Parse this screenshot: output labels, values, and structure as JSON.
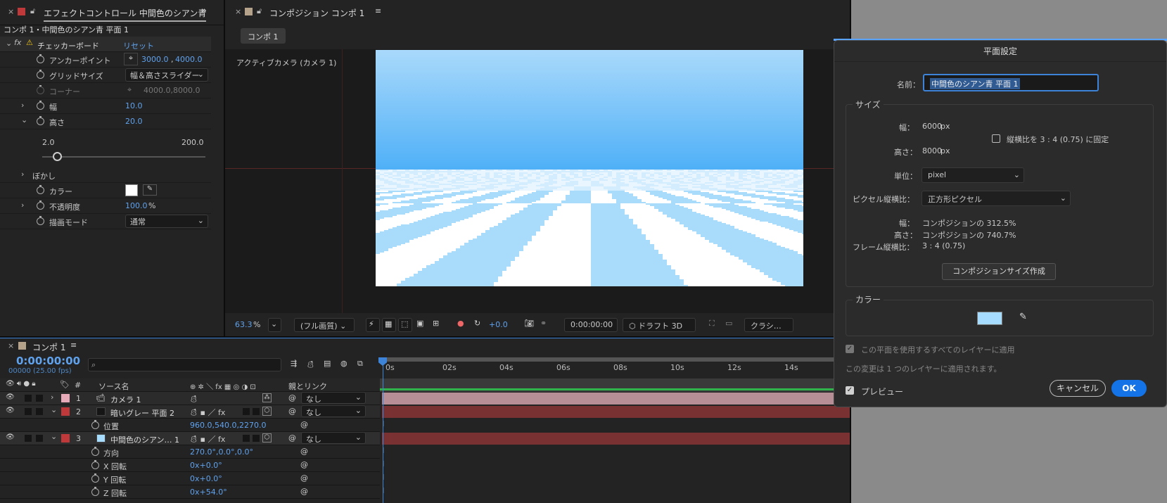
{
  "effect_panel": {
    "tab_title": "エフェクトコントロール 中間色のシアン青",
    "breadcrumb": "コンポ 1・中間色のシアン青 平面 1",
    "effect_name": "チェッカーボード",
    "reset": "リセット",
    "anchor": {
      "label": "アンカーポイント",
      "x": "3000.0",
      "sep": ",",
      "y": "4000.0"
    },
    "grid_size": {
      "label": "グリッドサイズ",
      "value": "幅＆高さスライダー"
    },
    "corner": {
      "label": "コーナー",
      "value": "4000.0,8000.0"
    },
    "width": {
      "label": "幅",
      "value": "10.0"
    },
    "height": {
      "label": "高さ",
      "value": "20.0",
      "min": "2.0",
      "max": "200.0",
      "slider_fraction": 0.09
    },
    "blur": {
      "label": "ぼかし"
    },
    "color": {
      "label": "カラー",
      "swatch": "#ffffff"
    },
    "opacity": {
      "label": "不透明度",
      "value": "100.0",
      "unit": "%"
    },
    "blend": {
      "label": "描画モード",
      "value": "通常"
    }
  },
  "comp_panel": {
    "tab_title": "コンポジション コンポ 1",
    "sub_tab": "コンポ 1",
    "camera_label": "アクティブカメラ (カメラ 1)",
    "zoom": "63.3",
    "zoom_unit": "%",
    "quality": "(フル画質)",
    "exposure": "+0.0",
    "timecode": "0:00:00:00",
    "renderer": "ドラフト 3D",
    "classic": "クラシ…",
    "sky_top": "#a9d9fb",
    "sky_bottom": "#4fb0f7",
    "checker_color": "#a9dcfb"
  },
  "timeline": {
    "tab_title": "コンポ 1",
    "timecode": "0:00:00:00",
    "frames": "00000 (25.00 fps)",
    "search_placeholder": "",
    "col_source": "ソース名",
    "col_switches": "⊕ ✲ ＼ fx ▦ ◎ ◑ ⊡",
    "col_parent": "親とリンク",
    "col_num": "#",
    "ticks": [
      "0s",
      "02s",
      "04s",
      "06s",
      "08s",
      "10s",
      "12s",
      "14s"
    ],
    "layers": [
      {
        "num": "1",
        "name": "カメラ 1",
        "label_color": "#e8a9b8",
        "parent": "なし",
        "track": "#b78e95"
      },
      {
        "num": "2",
        "name": "暗いグレー 平面 2",
        "label_color": "#c0393a",
        "parent": "なし",
        "track": "#7a3131"
      },
      {
        "num": "3",
        "name": "中間色のシアン… 1",
        "label_color": "#c0393a",
        "parent": "なし",
        "track": "#7a3131"
      }
    ],
    "position": {
      "label": "位置",
      "value": "960.0,540.0,2270.0"
    },
    "orientation": {
      "label": "方向",
      "value": "270.0°,0.0°,0.0°"
    },
    "xrot": {
      "label": "X 回転",
      "value": "0x+0.0°"
    },
    "yrot": {
      "label": "Y 回転",
      "value": "0x+0.0°"
    },
    "zrot": {
      "label": "Z 回転",
      "value": "0x+54.0°"
    }
  },
  "dialog": {
    "title": "平面設定",
    "name_label": "名前：",
    "name_value": "中間色のシアン青 平面 1",
    "size_group": "サイズ",
    "width_label": "幅：",
    "width_value": "6000",
    "height_label": "高さ：",
    "height_value": "8000",
    "px": "px",
    "lock_aspect": "縦横比を 3 : 4 (0.75) に固定",
    "unit_label": "単位：",
    "unit_value": "pixel",
    "pixel_aspect_label": "ピクセル縦横比：",
    "pixel_aspect_value": "正方形ピクセル",
    "info_width_label": "幅：",
    "info_width_value": "コンポジションの 312.5%",
    "info_height_label": "高さ：",
    "info_height_value": "コンポジションの 740.7%",
    "frame_aspect_label": "フレーム縦横比：",
    "frame_aspect_value": "3 : 4 (0.75)",
    "make_comp_size": "コンポジションサイズ作成",
    "color_group": "カラー",
    "color_swatch": "#a6dcff",
    "apply_all": "この平面を使用するすべてのレイヤーに適用",
    "change_note": "この変更は 1 つのレイヤーに適用されます。",
    "preview": "プレビュー",
    "cancel": "キャンセル",
    "ok": "OK"
  }
}
